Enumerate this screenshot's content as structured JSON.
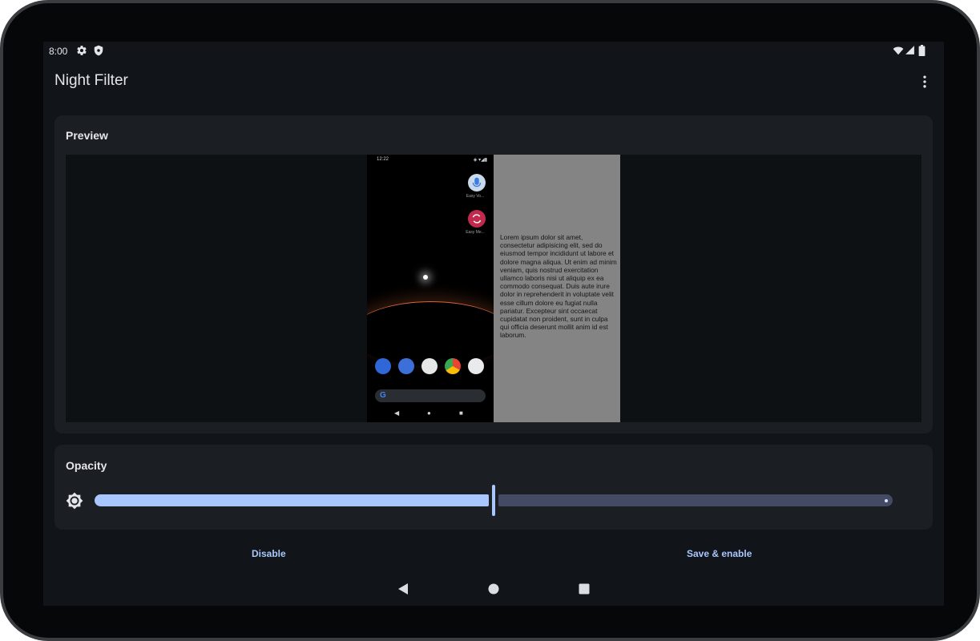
{
  "status_bar": {
    "time": "8:00",
    "left_icons": [
      "gear-icon",
      "shield-icon"
    ],
    "right_icons": [
      "wifi-icon",
      "signal-icon",
      "battery-icon"
    ]
  },
  "app_bar": {
    "title": "Night Filter",
    "menu_icon": "more-vert-icon"
  },
  "preview_card": {
    "title": "Preview",
    "phone_preview": {
      "time": "12:22",
      "widgets": [
        "Easy Vo...",
        "Easy Me..."
      ],
      "dock_apps": [
        "phone-icon",
        "messages-icon",
        "play-store-icon",
        "chrome-icon",
        "camera-icon"
      ]
    },
    "sample_text": "Lorem ipsum dolor sit amet, consectetur adipisicing elit, sed do eiusmod tempor incididunt ut labore et dolore magna aliqua. Ut enim ad minim veniam, quis nostrud exercitation ullamco laboris nisi ut aliquip ex ea commodo consequat. Duis aute irure dolor in reprehenderit in voluptate velit esse cillum dolore eu fugiat nulla pariatur. Excepteur sint occaecat cupidatat non proident, sunt in culpa qui officia deserunt mollit anim id est laborum."
  },
  "opacity_card": {
    "title": "Opacity",
    "value_fraction": 0.5,
    "start_icon": "brightness-icon",
    "end_icon": "moon-icon"
  },
  "actions": {
    "disable_label": "Disable",
    "save_label": "Save & enable"
  },
  "navigation": [
    "back-icon",
    "home-icon",
    "recents-icon"
  ],
  "colors": {
    "accent": "#a9c7ff",
    "track_inactive": "#444a63",
    "background": "#111418",
    "card": "#1b1f24"
  }
}
